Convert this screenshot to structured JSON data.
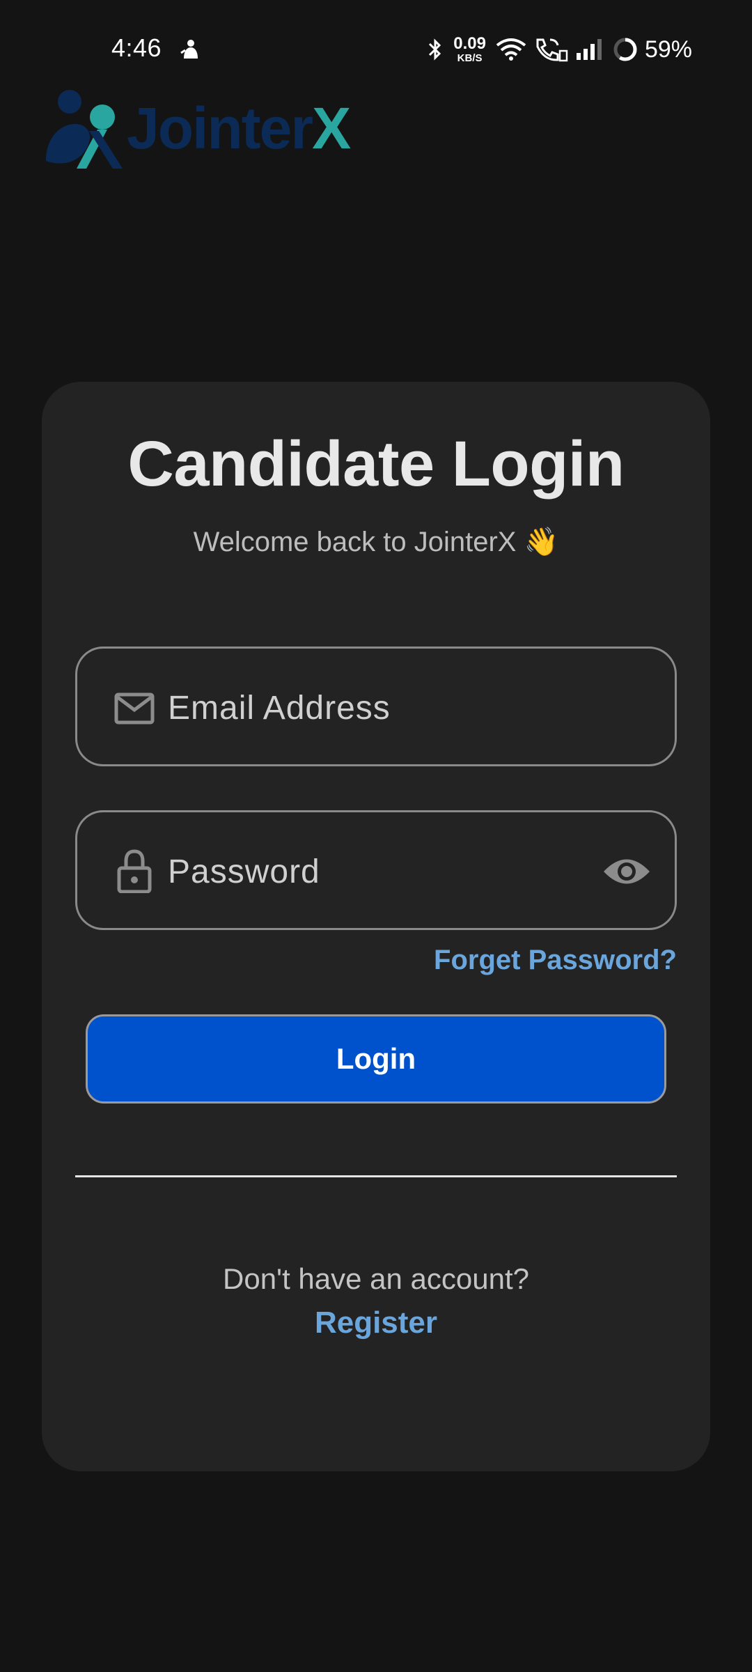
{
  "status_bar": {
    "time": "4:46",
    "net_speed_value": "0.09",
    "net_speed_unit": "KB/S",
    "battery": "59%",
    "icons": [
      "notification-icon",
      "bluetooth-icon",
      "wifi-icon",
      "wifi-call-icon",
      "signal-icon",
      "battery-ring-icon"
    ]
  },
  "logo": {
    "name_main": "Jointer",
    "name_accent": "X",
    "colors": {
      "primary": "#0b2a55",
      "accent": "#2aa6a0"
    }
  },
  "card": {
    "title": "Candidate Login",
    "subtitle": "Welcome back to JointerX 👋"
  },
  "form": {
    "email": {
      "placeholder": "Email Address",
      "value": "",
      "icon": "mail-icon"
    },
    "password": {
      "placeholder": "Password",
      "value": "",
      "icon": "lock-icon",
      "toggle_icon": "eye-icon"
    },
    "forget_password": "Forget Password?",
    "login_button": "Login"
  },
  "footer": {
    "no_account_text": "Don't have an account?",
    "register_link": "Register"
  },
  "colors": {
    "background": "#141414",
    "card": "#232323",
    "button": "#0052cc",
    "link": "#6aa6dc"
  }
}
